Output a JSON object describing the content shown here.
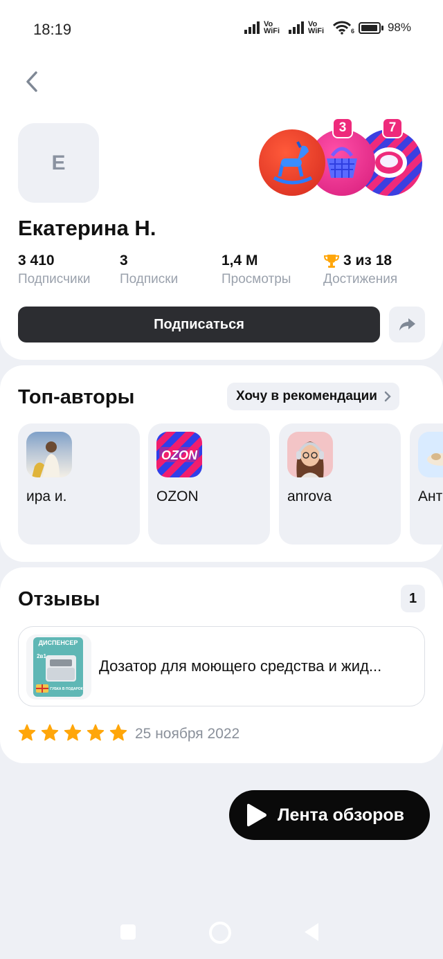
{
  "status_bar": {
    "time": "18:19",
    "battery": "98%",
    "network_1": "Vo WiFi",
    "network_2": "Vo WiFi",
    "wifi_badge": "6",
    "battery_level_percent": 98
  },
  "profile": {
    "avatar_letter": "E",
    "name": "Екатерина Н.",
    "badges": [
      {
        "icon": "rocking-horse-icon",
        "count": null
      },
      {
        "icon": "basket-icon",
        "count": "3"
      },
      {
        "icon": "ring-icon",
        "count": "7"
      }
    ],
    "stats": [
      {
        "value": "3 410",
        "label": "Подписчики"
      },
      {
        "value": "3",
        "label": "Подписки"
      },
      {
        "value": "1,4 М",
        "label": "Просмотры"
      },
      {
        "value": "3 из 18",
        "label": "Достижения",
        "icon": "trophy-icon"
      }
    ],
    "subscribe_label": "Подписаться"
  },
  "top_authors": {
    "title": "Топ-авторы",
    "recommend_label": "Хочу в рекомендации",
    "authors": [
      {
        "name": "ира и."
      },
      {
        "name": "OZON"
      },
      {
        "name": "anrova"
      },
      {
        "name": "Ант"
      }
    ]
  },
  "reviews": {
    "title": "Отзывы",
    "count": "1",
    "item": {
      "product": "Дозатор для моющего средства и жид...",
      "thumb_text_1": "ДИСПЕНСЕР",
      "thumb_text_2": "2в1",
      "thumb_text_3": "ГУБКА В ПОДАРОК",
      "rating": 5,
      "date": "25 ноября 2022"
    }
  },
  "feed_button_label": "Лента обзоров",
  "colors": {
    "accent_pink": "#ee2a7b",
    "star": "#ffa60a",
    "dark_button": "#2c2d31"
  }
}
